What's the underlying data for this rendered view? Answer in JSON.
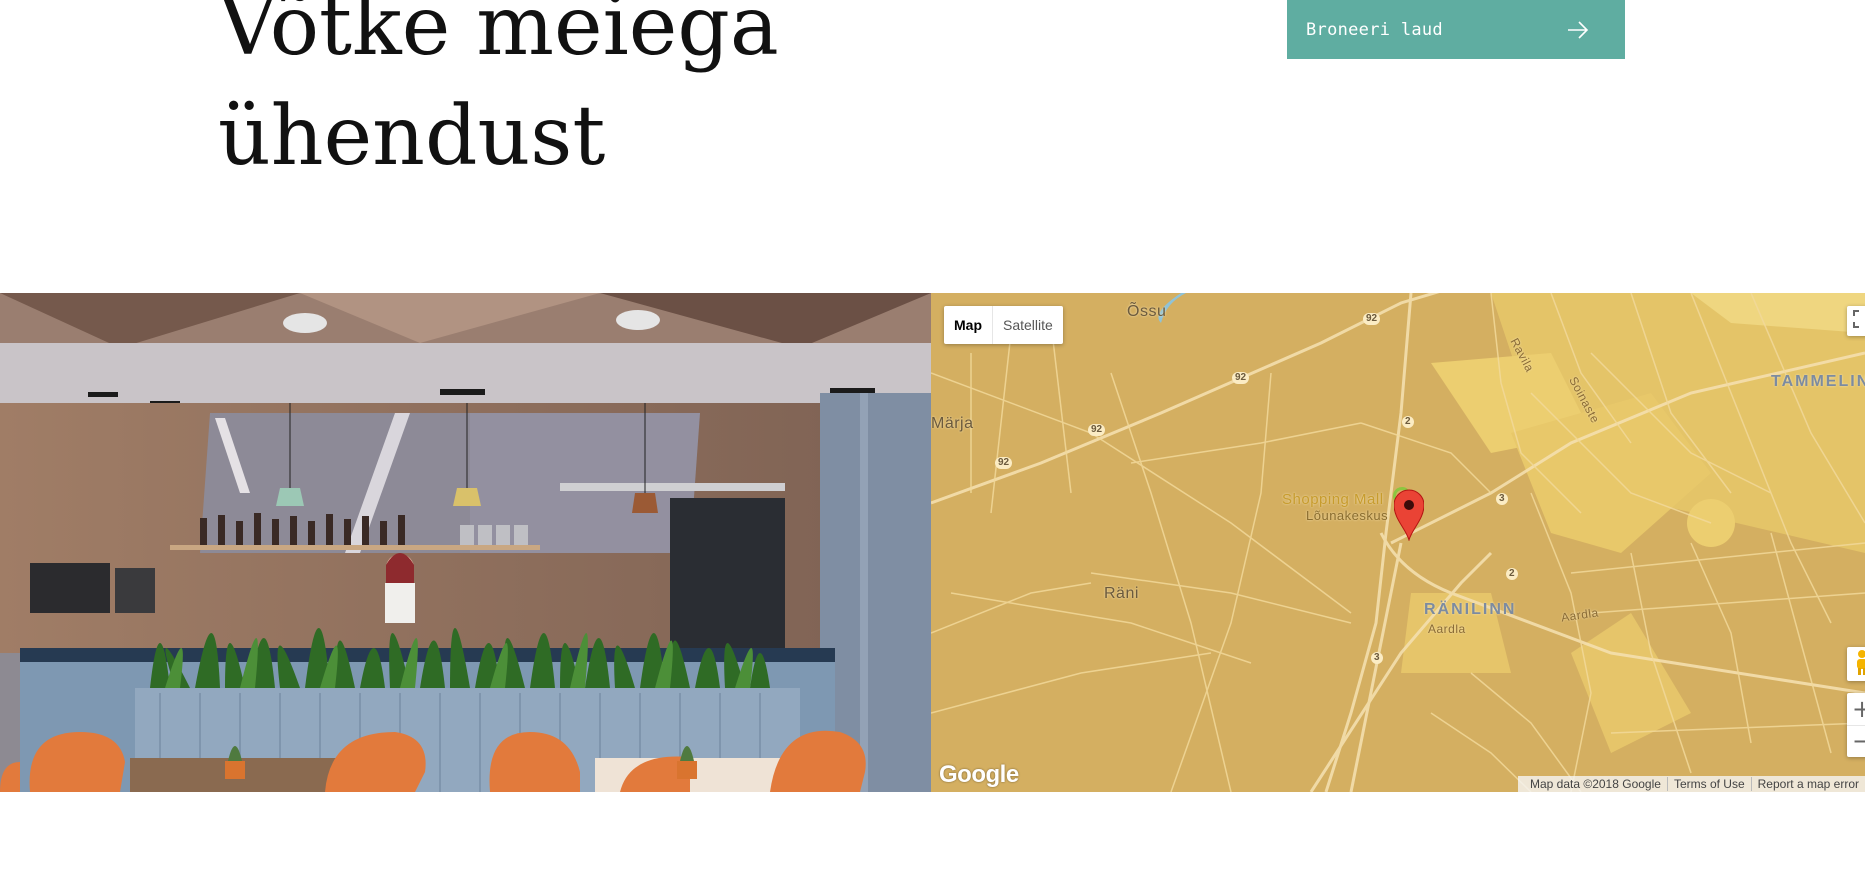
{
  "heading": {
    "line1": "Võtke meiega",
    "line2": "ühendust"
  },
  "book_button": {
    "label": "Broneeri laud",
    "icon": "arrow-right-icon"
  },
  "map": {
    "map_type": {
      "map": "Map",
      "satellite": "Satellite"
    },
    "places": {
      "ossu": "Õssu",
      "marja": "Märja",
      "rani": "Räni",
      "ranilinn": "RÄNILINN",
      "tammelinn": "TAMMELINN",
      "mall": "Shopping Mall",
      "mall_name": "Lõunakeskus",
      "aardla1": "Aardla",
      "aardla2": "Aardla",
      "ravila": "Ravila",
      "soinaste": "Soinaste"
    },
    "road_numbers": {
      "r92a": "92",
      "r92b": "92",
      "r92c": "92",
      "r92d": "92",
      "r2a": "2",
      "r2b": "2",
      "r3a": "3",
      "r3b": "3"
    },
    "google_logo": "Google",
    "attribution": {
      "data": "Map data ©2018 Google",
      "terms": "Terms of Use",
      "report": "Report a map error"
    },
    "zoom": {
      "in": "+",
      "out": "−"
    },
    "colors": {
      "base": "#d4af61",
      "highlight": "#ecce70",
      "road": "#f6e3b4",
      "marker": "#ea4335"
    }
  }
}
